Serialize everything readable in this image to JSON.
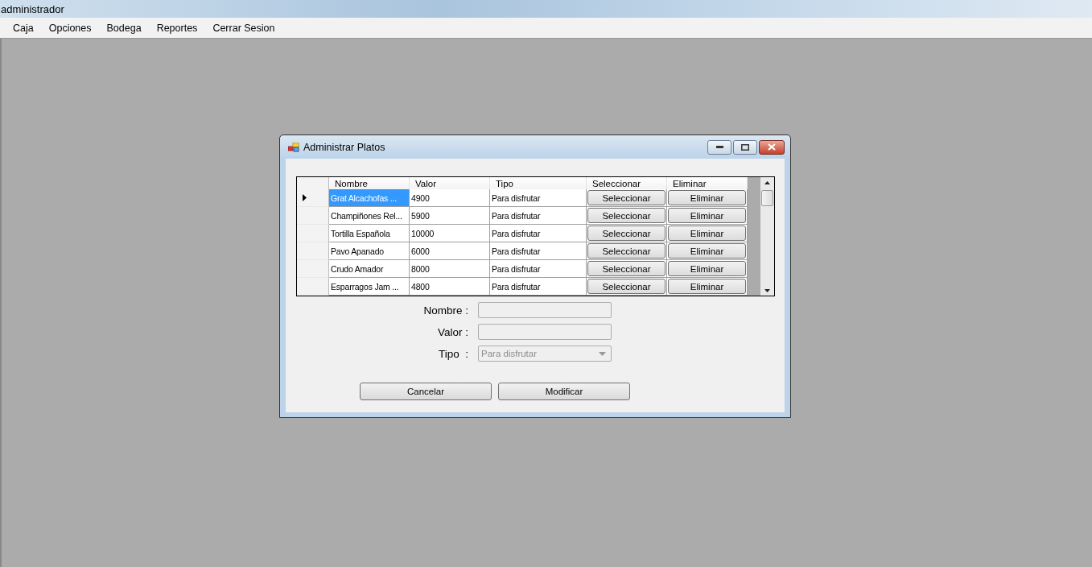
{
  "window": {
    "title": "administrador"
  },
  "menu": [
    "Caja",
    "Opciones",
    "Bodega",
    "Reportes",
    "Cerrar Sesion"
  ],
  "dialog": {
    "title": "Administrar Platos",
    "table": {
      "columns": [
        "Nombre",
        "Valor",
        "Tipo",
        "Seleccionar",
        "Eliminar"
      ],
      "rows": [
        {
          "nombre": "Grat Alcachofas ...",
          "valor": "4900",
          "tipo": "Para disfrutar",
          "select_button": "Seleccionar",
          "delete_button": "Eliminar",
          "selected": true
        },
        {
          "nombre": "Champiñones Rel...",
          "valor": "5900",
          "tipo": "Para disfrutar",
          "select_button": "Seleccionar",
          "delete_button": "Eliminar",
          "selected": false
        },
        {
          "nombre": "Tortilla Española",
          "valor": "10000",
          "tipo": "Para disfrutar",
          "select_button": "Seleccionar",
          "delete_button": "Eliminar",
          "selected": false
        },
        {
          "nombre": "Pavo Apanado",
          "valor": "6000",
          "tipo": "Para disfrutar",
          "select_button": "Seleccionar",
          "delete_button": "Eliminar",
          "selected": false
        },
        {
          "nombre": "Crudo Amador",
          "valor": "8000",
          "tipo": "Para disfrutar",
          "select_button": "Seleccionar",
          "delete_button": "Eliminar",
          "selected": false
        },
        {
          "nombre": "Esparragos Jam ...",
          "valor": "4800",
          "tipo": "Para disfrutar",
          "select_button": "Seleccionar",
          "delete_button": "Eliminar",
          "selected": false
        }
      ]
    },
    "form": [
      {
        "kind": "text",
        "label": "Nombre :",
        "disabled": true
      },
      {
        "kind": "text",
        "label": "Valor :",
        "disabled": true
      },
      {
        "kind": "select",
        "label": "Tipo  :",
        "value": "Para disfrutar",
        "disabled": true
      }
    ],
    "buttons": [
      "Cancelar",
      "Modificar"
    ]
  }
}
